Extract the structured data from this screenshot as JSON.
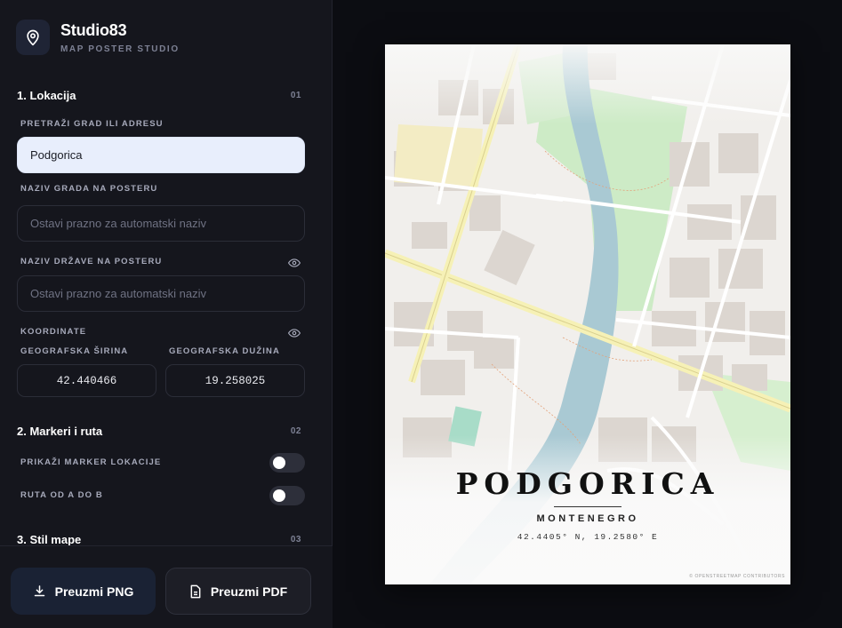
{
  "brand": {
    "title": "Studio83",
    "subtitle": "MAP POSTER STUDIO",
    "icon": "map-pin-icon"
  },
  "section1": {
    "title": "1. Lokacija",
    "num": "01"
  },
  "search": {
    "label": "PRETRAŽI GRAD ILI ADRESU",
    "value": "Podgorica"
  },
  "city_name": {
    "label": "NAZIV GRADA NA POSTERU",
    "placeholder": "Ostavi prazno za automatski naziv"
  },
  "country_name": {
    "label": "NAZIV DRŽAVE NA POSTERU",
    "placeholder": "Ostavi prazno za automatski naziv"
  },
  "coordinates": {
    "label": "KOORDINATE",
    "lat_label": "GEOGRAFSKA ŠIRINA",
    "lon_label": "GEOGRAFSKA DUŽINA",
    "lat_value": "42.440466",
    "lon_value": "19.258025"
  },
  "section2": {
    "title": "2. Markeri i ruta",
    "num": "02"
  },
  "toggles": {
    "marker_label": "PRIKAŽI MARKER LOKACIJE",
    "marker_on": false,
    "route_label": "RUTA OD A DO B",
    "route_on": false
  },
  "section3": {
    "title": "3. Stil mape",
    "num": "03"
  },
  "actions": {
    "png_label": "Preuzmi PNG",
    "pdf_label": "Preuzmi PDF"
  },
  "poster": {
    "city": "PODGORICA",
    "country": "MONTENEGRO",
    "coords": "42.4405° N, 19.2580° E",
    "attribution": "© OPENSTREETMAP CONTRIBUTORS"
  },
  "colors": {
    "accent_input": "#e8eefc",
    "sidebar_bg": "#15161d",
    "page_bg": "#0c0d12",
    "river": "#a9c9d3",
    "park": "#cdebc6",
    "road": "#f6f1b6"
  }
}
